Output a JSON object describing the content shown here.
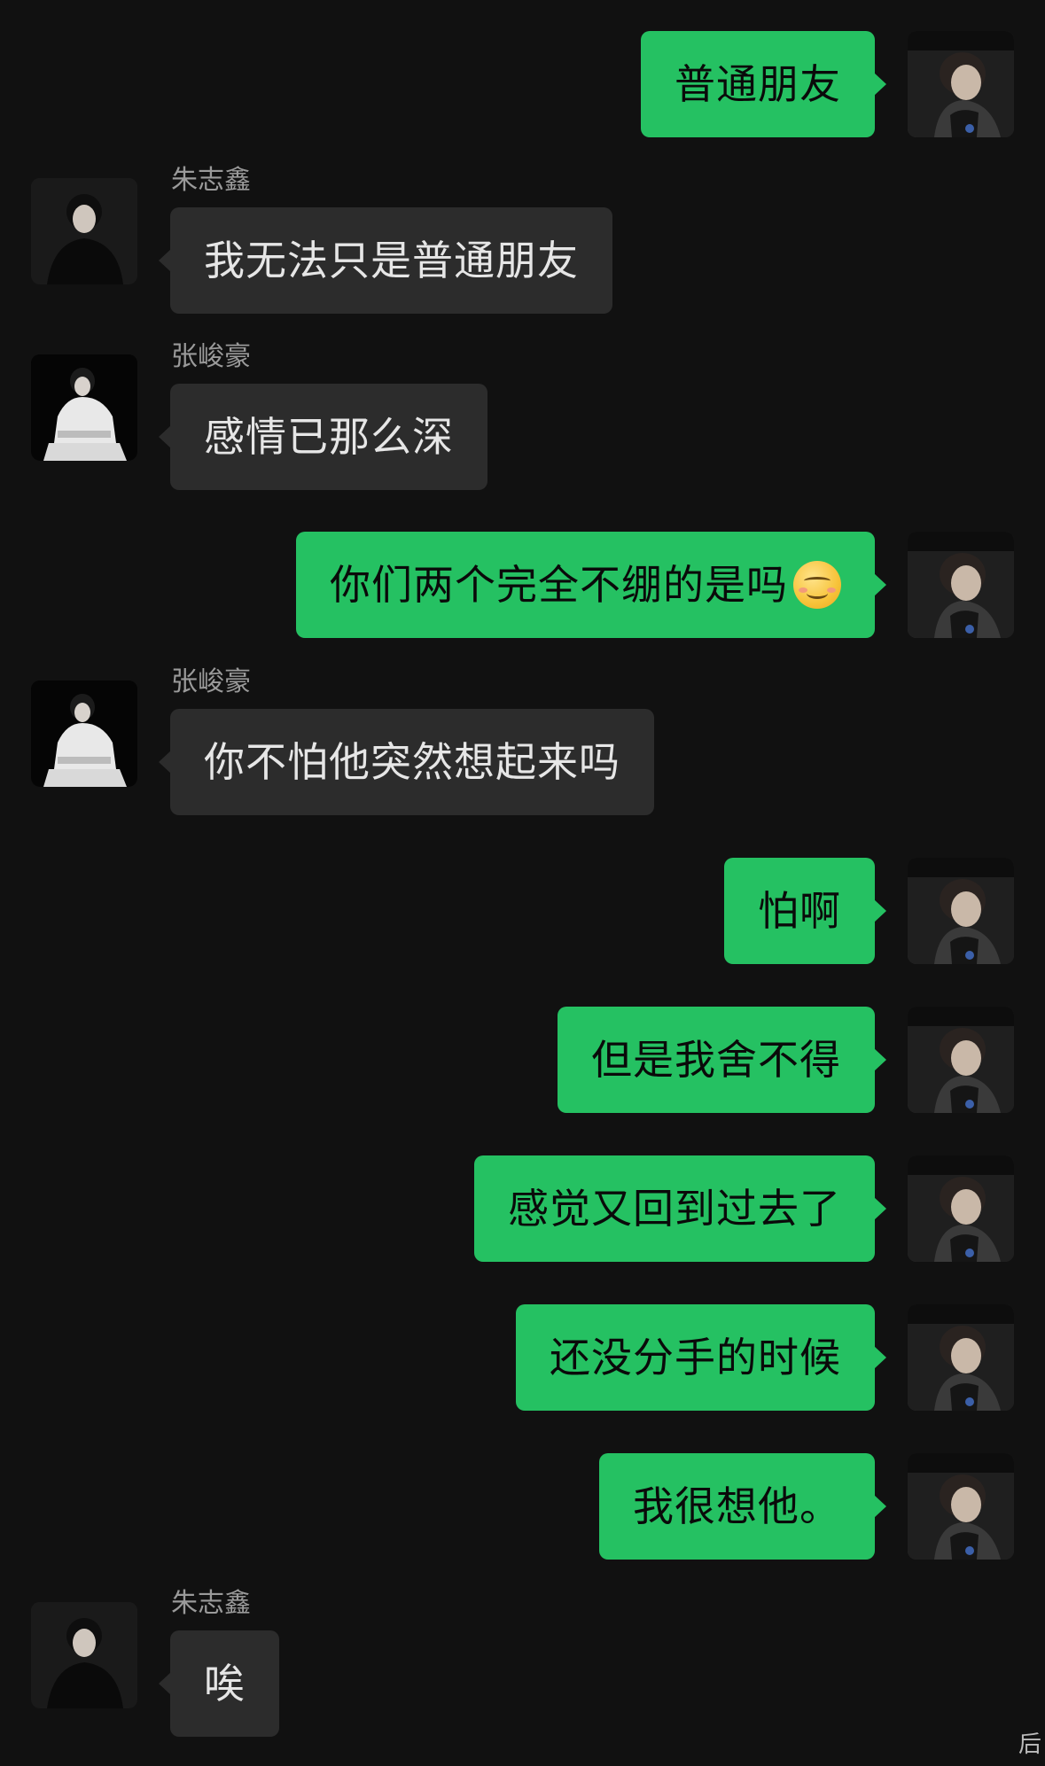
{
  "contacts": {
    "me": {
      "avatar_icon": "avatar-boy-dark-jacket"
    },
    "zhu": {
      "name": "朱志鑫",
      "avatar_icon": "avatar-boy-black-outfit"
    },
    "zhang": {
      "name": "张峻豪",
      "avatar_icon": "avatar-boy-white-outfit-sitting"
    }
  },
  "messages": [
    {
      "from": "me",
      "text": "普通朋友"
    },
    {
      "from": "zhu",
      "name": "朱志鑫",
      "text": "我无法只是普通朋友"
    },
    {
      "from": "zhang",
      "name": "张峻豪",
      "text": "感情已那么深"
    },
    {
      "from": "me",
      "text": "你们两个完全不绷的是吗",
      "emoji": "smiling-face-emoji"
    },
    {
      "from": "zhang",
      "name": "张峻豪",
      "text": "你不怕他突然想起来吗"
    },
    {
      "from": "me",
      "text": "怕啊"
    },
    {
      "from": "me",
      "text": "但是我舍不得"
    },
    {
      "from": "me",
      "text": "感觉又回到过去了"
    },
    {
      "from": "me",
      "text": "还没分手的时候"
    },
    {
      "from": "me",
      "text": "我很想他。"
    },
    {
      "from": "zhu",
      "name": "朱志鑫",
      "text": "唉"
    }
  ],
  "colors": {
    "background": "#111111",
    "my_bubble": "#25c162",
    "other_bubble": "#2c2c2c"
  },
  "corner_mark": "后"
}
